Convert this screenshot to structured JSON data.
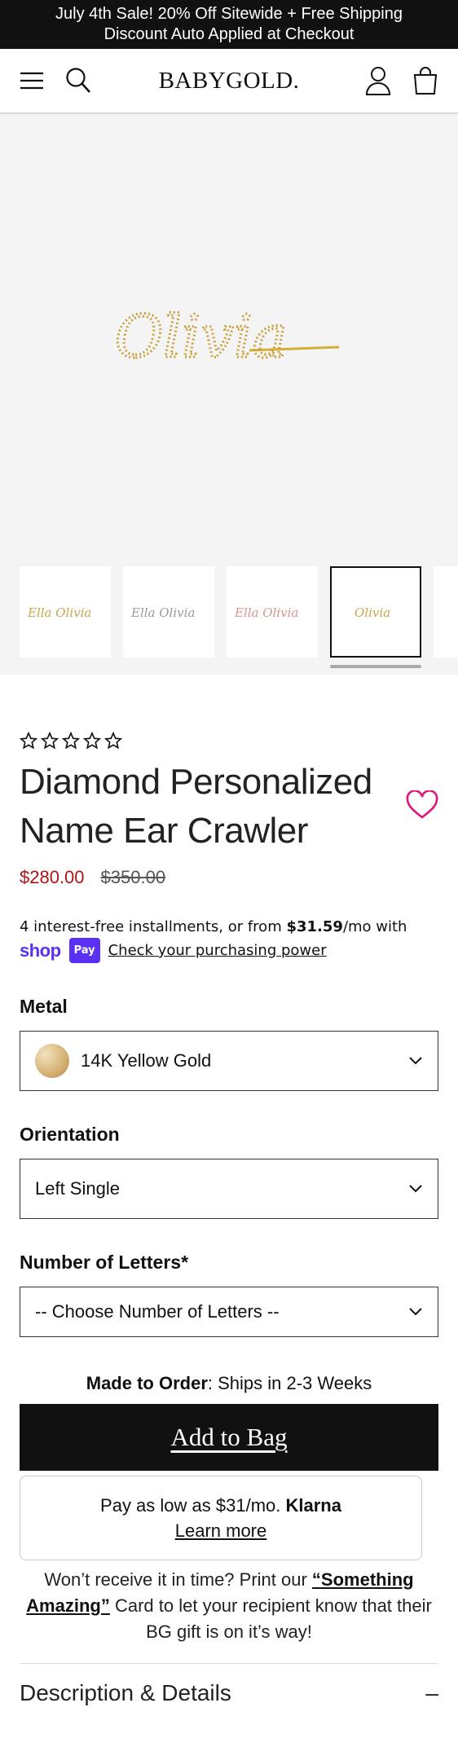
{
  "promo": {
    "line1": "July 4th Sale! 20% Off Sitewide + Free Shipping",
    "line2": "Discount Auto Applied at Checkout"
  },
  "header": {
    "logo": "BABYGOLD.",
    "icons": [
      "menu-icon",
      "search-icon",
      "account-icon",
      "bag-icon"
    ]
  },
  "gallery": {
    "hero_text": "Olivia",
    "thumbnails": [
      {
        "text": "Ella Olivia",
        "tone": "#c9a64a"
      },
      {
        "text": "Ella Olivia",
        "tone": "#9a9a9a"
      },
      {
        "text": "Ella Olivia",
        "tone": "#d9958a"
      },
      {
        "text": "Olivia",
        "tone": "#c9a64a"
      }
    ]
  },
  "product": {
    "rating_stars": 5,
    "title": "Diamond Personalized Name Ear Crawler",
    "price_now": "$280.00",
    "price_old": "$350.00",
    "installments_prefix": "4 interest-free installments, or from ",
    "installments_amount": "$31.59",
    "installments_suffix": "/mo with",
    "shop_word": "shop",
    "pay_badge": "Pay",
    "check_power": "Check your purchasing power"
  },
  "options": {
    "metal_label": "Metal",
    "metal_value": "14K Yellow Gold",
    "orientation_label": "Orientation",
    "orientation_value": "Left Single",
    "letters_label": "Number of Letters*",
    "letters_value": "-- Choose Number of Letters --"
  },
  "purchase": {
    "ship_bold": "Made to Order",
    "ship_rest": ": Ships in 2-3 Weeks",
    "add_to_bag": "Add to Bag",
    "klarna_line_prefix": "Pay as low as $31/mo. ",
    "klarna_brand": "Klarna",
    "klarna_learn": "Learn more",
    "note_prefix": "Won’t receive it in time? Print our ",
    "note_link": "“Something Amazing”",
    "note_suffix": " Card to let your recipient know that their BG gift is on it’s way!"
  },
  "details": {
    "label": "Description & Details",
    "toggle": "–"
  },
  "colors": {
    "accent_price": "#b31217",
    "heart": "#e0147a",
    "shop_pay": "#5a31f4"
  }
}
